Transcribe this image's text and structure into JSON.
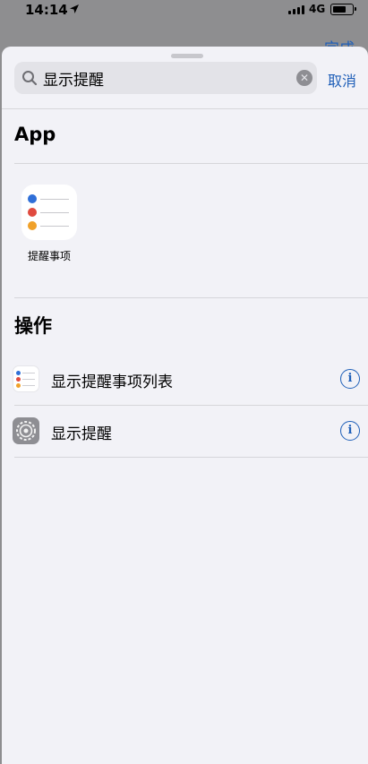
{
  "status_bar": {
    "time": "14:14",
    "network": "4G",
    "icons": [
      "location-arrow-icon",
      "signal-icon",
      "battery-icon"
    ]
  },
  "behind_sheet": {
    "done_label": "完成"
  },
  "search": {
    "query": "显示提醒",
    "cancel_label": "取消",
    "icons": [
      "search-icon",
      "clear-icon"
    ]
  },
  "sections": {
    "app": {
      "title": "App",
      "items": [
        {
          "label": "提醒事项",
          "icon": "reminders-app-icon"
        }
      ]
    },
    "actions": {
      "title": "操作",
      "items": [
        {
          "label": "显示提醒事项列表",
          "icon": "reminders-icon"
        },
        {
          "label": "显示提醒",
          "icon": "settings-gear-icon"
        }
      ]
    }
  },
  "colors": {
    "accent": "#1f5fb8",
    "sheet_bg": "#f2f2f7",
    "dimmed_bg": "#8e8e90",
    "reminder_dots": [
      "#2f6fd8",
      "#e04a3f",
      "#f0a12a"
    ]
  }
}
